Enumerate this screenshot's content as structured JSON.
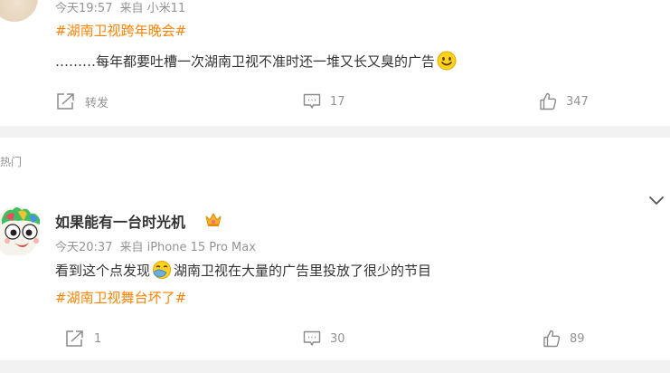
{
  "post1": {
    "meta": {
      "time": "今天19:57",
      "source": "来自 小米11"
    },
    "hashtag": "#湖南卫视跨年晚会#",
    "content": "………每年都要吐槽一次湖南卫视不准时还一堆又长又臭的广告",
    "actions": {
      "repost_label": "转发",
      "comments": "17",
      "likes": "347"
    }
  },
  "section_label": "热门",
  "post2": {
    "username": "如果能有一台时光机",
    "meta": {
      "time": "今天20:37",
      "source": "来自 iPhone 15 Pro Max"
    },
    "content_before": "看到这个点发现",
    "content_after": "湖南卫视在大量的广告里投放了很少的节目",
    "hashtag": "#湖南卫视舞台坏了#",
    "actions": {
      "reposts": "1",
      "comments": "30",
      "likes": "89"
    }
  },
  "colors": {
    "hashtag": "#ff8200",
    "meta": "#939393",
    "text": "#333333",
    "separator": "#f2f2f2"
  },
  "icons": [
    "repost-icon",
    "comment-icon",
    "like-icon",
    "smile-emoji",
    "facepalm-emoji",
    "crown-icon",
    "chevron-down-icon"
  ]
}
